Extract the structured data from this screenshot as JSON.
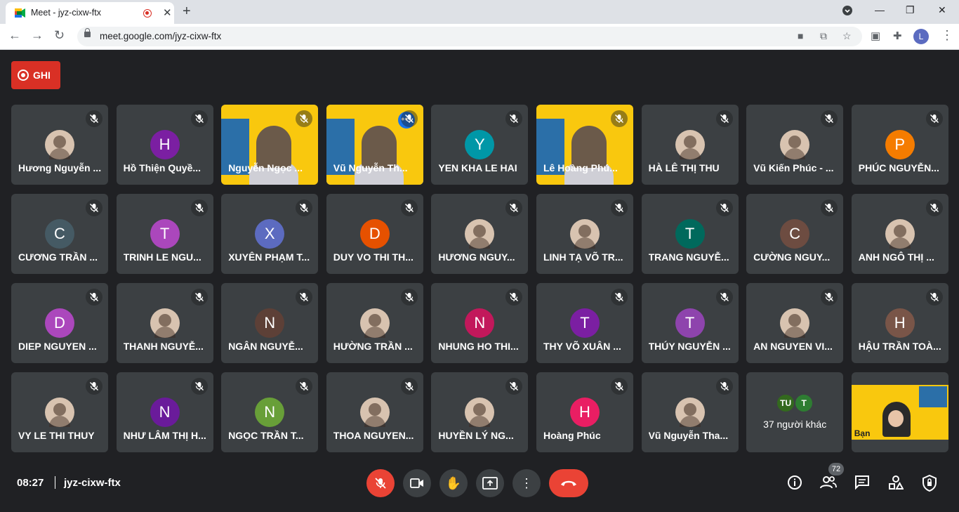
{
  "browser": {
    "tab_title": "Meet - jyz-cixw-ftx",
    "url": "meet.google.com/jyz-cixw-ftx",
    "profile_initial": "L"
  },
  "record": {
    "label": "GHI"
  },
  "participants": [
    {
      "name": "Hương Nguyễn ...",
      "type": "photo"
    },
    {
      "name": "Hồ Thiện Quyề...",
      "initial": "H",
      "color": "#7b1fa2"
    },
    {
      "name": "Nguyễn Ngọc ...",
      "type": "video"
    },
    {
      "name": "Vũ Nguyễn Th...",
      "type": "video",
      "active": true
    },
    {
      "name": "YEN KHA LE HAI",
      "initial": "Y",
      "color": "#0097a7"
    },
    {
      "name": "Lê Hoàng Phú...",
      "type": "video"
    },
    {
      "name": "HÀ LÊ THỊ THU",
      "type": "photo"
    },
    {
      "name": "Vũ Kiến Phúc - ...",
      "type": "photo"
    },
    {
      "name": "PHÚC NGUYỄN...",
      "initial": "P",
      "color": "#f57c00"
    },
    {
      "name": "CƯƠNG TRẦN ...",
      "initial": "C",
      "color": "#455a64"
    },
    {
      "name": "TRINH LE NGU...",
      "initial": "T",
      "color": "#ab47bc"
    },
    {
      "name": "XUYÊN PHẠM T...",
      "initial": "X",
      "color": "#5c6bc0"
    },
    {
      "name": "DUY VO THI TH...",
      "initial": "D",
      "color": "#e65100"
    },
    {
      "name": "HƯƠNG NGUY...",
      "type": "photo"
    },
    {
      "name": "LINH TẠ VÕ TR...",
      "type": "photo"
    },
    {
      "name": "TRANG NGUYỄ...",
      "initial": "T",
      "color": "#00695c"
    },
    {
      "name": "CƯỜNG NGUY...",
      "initial": "C",
      "color": "#6d4c41"
    },
    {
      "name": "ANH NGÔ THỊ ...",
      "type": "photo"
    },
    {
      "name": "DIEP NGUYEN ...",
      "initial": "D",
      "color": "#ab47bc"
    },
    {
      "name": "THANH NGUYỄ...",
      "type": "photo"
    },
    {
      "name": "NGÂN NGUYỄ...",
      "initial": "N",
      "color": "#5d4037"
    },
    {
      "name": "HƯỜNG TRẦN ...",
      "type": "photo"
    },
    {
      "name": "NHUNG HO THI...",
      "initial": "N",
      "color": "#c2185b"
    },
    {
      "name": "THY VÕ XUÂN ...",
      "initial": "T",
      "color": "#7b1fa2"
    },
    {
      "name": "THÚY NGUYỄN ...",
      "initial": "T",
      "color": "#8e44ad"
    },
    {
      "name": "AN NGUYEN VI...",
      "type": "photo"
    },
    {
      "name": "HẬU TRẦN TOÀ...",
      "initial": "H",
      "color": "#795548"
    },
    {
      "name": "VY LE THI THUY",
      "type": "photo"
    },
    {
      "name": "NHƯ LÂM THỊ H...",
      "initial": "N",
      "color": "#6a1b9a"
    },
    {
      "name": "NGỌC TRẦN T...",
      "initial": "N",
      "color": "#689f38"
    },
    {
      "name": "THOA NGUYEN...",
      "type": "photo"
    },
    {
      "name": "HUYỀN LÝ NG...",
      "type": "photo"
    },
    {
      "name": "Hoàng Phúc",
      "initial": "H",
      "color": "#e91e63"
    },
    {
      "name": "Vũ Nguyễn Tha...",
      "type": "photo",
      "mic_muted_dark": true
    }
  ],
  "others": {
    "label": "37 người khác",
    "avatars": [
      {
        "text": "TU",
        "color": "#33691e"
      },
      {
        "text": "T",
        "color": "#2e7d32"
      }
    ]
  },
  "self": {
    "label": "Bạn"
  },
  "bottom": {
    "time": "08:27",
    "meeting_code": "jyz-cixw-ftx",
    "people_count": "72"
  },
  "icons": {
    "mic_off": "mic-off-icon",
    "camera": "camera-icon",
    "raise_hand": "raise-hand-icon",
    "present": "present-screen-icon",
    "more": "more-options-icon",
    "leave": "leave-call-icon",
    "info": "info-icon",
    "people": "people-icon",
    "chat": "chat-icon",
    "activities": "activities-icon",
    "host_controls": "host-controls-icon"
  },
  "colors": {
    "background": "#202124",
    "tile": "#3c4043",
    "danger": "#ea4335",
    "active_border": "#8ab4f8"
  }
}
